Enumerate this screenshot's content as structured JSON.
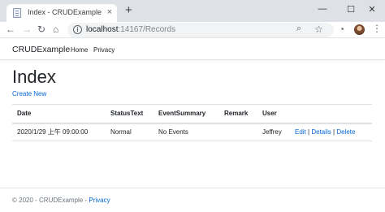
{
  "browser": {
    "tab_title": "Index - CRUDExample",
    "tab_close": "×",
    "new_tab": "+",
    "win_min": "—",
    "win_max": "☐",
    "win_close": "✕",
    "url_host": "localhost",
    "url_path": ":14167/Records",
    "icons": {
      "back": "arrow-left-icon",
      "forward": "arrow-right-icon",
      "reload": "reload-icon",
      "home": "home-icon",
      "info": "info-icon",
      "zoom": "zoom-icon",
      "star": "star-icon",
      "extension": "extension-icon",
      "avatar": "avatar",
      "menu": "menu-icon"
    }
  },
  "navbar": {
    "brand": "CRUDExample",
    "links": [
      "Home",
      "Privacy"
    ]
  },
  "main": {
    "title": "Index",
    "create_link": "Create New",
    "table": {
      "headers": [
        "Date",
        "StatusText",
        "EventSummary",
        "Remark",
        "User",
        ""
      ],
      "rows": [
        {
          "date": "2020/1/29 上午 09:00:00",
          "status": "Normal",
          "event_summary": "No Events",
          "remark": "",
          "user": "Jeffrey",
          "actions": [
            "Edit",
            "Details",
            "Delete"
          ],
          "separator": "|"
        }
      ]
    }
  },
  "footer": {
    "text": "© 2020 - CRUDExample -",
    "link": "Privacy"
  },
  "colors": {
    "link": "#0366d6",
    "chrome_bg": "#dee1e6",
    "omnibox_bg": "#f1f3f4"
  }
}
